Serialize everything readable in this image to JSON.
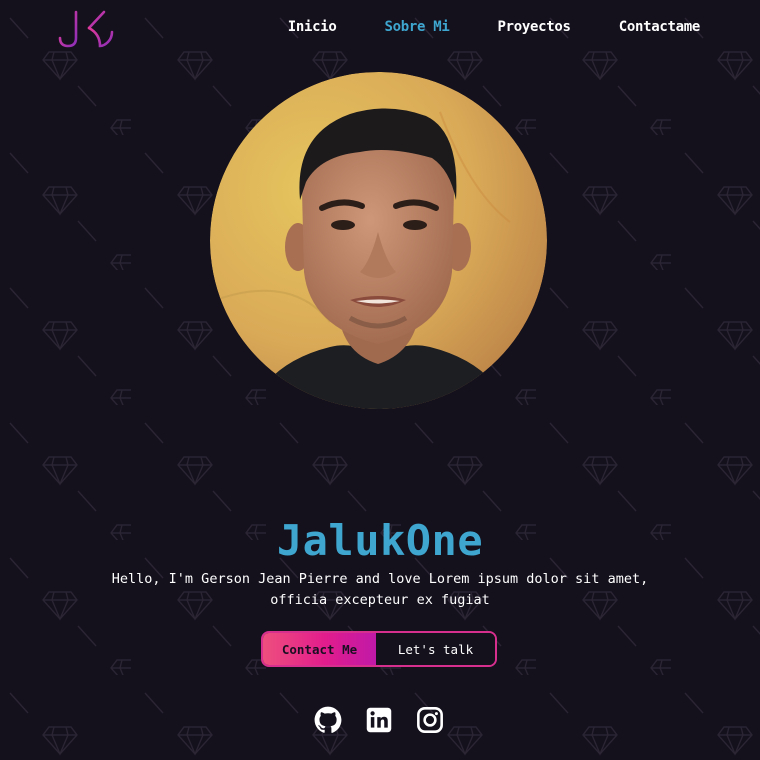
{
  "nav": {
    "logo_text": "JK",
    "links": [
      {
        "label": "Inicio",
        "active": false
      },
      {
        "label": "Sobre Mi",
        "active": true
      },
      {
        "label": "Proyectos",
        "active": false
      },
      {
        "label": "Contactame",
        "active": false
      }
    ]
  },
  "hero": {
    "name": "JalukOne",
    "bio_line1": "Hello, I'm Gerson Jean Pierre and love Lorem ipsum dolor sit amet,",
    "bio_line2": "officia excepteur ex fugiat",
    "primary_button": "Contact Me",
    "secondary_button": "Let's talk"
  },
  "socials": [
    {
      "icon": "github-icon"
    },
    {
      "icon": "linkedin-icon"
    },
    {
      "icon": "instagram-icon"
    }
  ],
  "colors": {
    "background": "#14101c",
    "accent_blue": "#3ea6cf",
    "accent_pink": "#e21c8c"
  }
}
